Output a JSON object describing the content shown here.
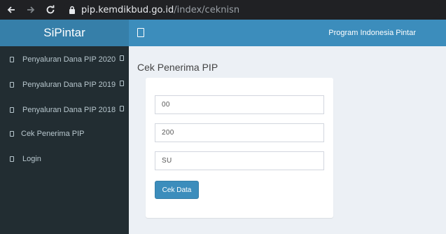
{
  "browser": {
    "url_host": "pip.kemdikbud.go.id",
    "url_path": "/index/ceknisn"
  },
  "app": {
    "brand": "SiPintar",
    "topbar_title": "Program Indonesia Pintar"
  },
  "sidebar": {
    "items": [
      {
        "label": "Penyaluran Dana PIP 2020",
        "has_caret": true
      },
      {
        "label": "Penyaluran Dana PIP 2019",
        "has_caret": true
      },
      {
        "label": "Penyaluran Dana PIP 2018",
        "has_caret": true
      },
      {
        "label": "Cek Penerima PIP",
        "has_caret": false
      },
      {
        "label": "Login",
        "has_caret": false
      }
    ]
  },
  "main": {
    "title": "Cek Penerima PIP",
    "fields": [
      {
        "value": "00"
      },
      {
        "value": "200"
      },
      {
        "value": "SU"
      }
    ],
    "submit_label": "Cek Data"
  },
  "colors": {
    "brand_bg": "#367fa9",
    "topbar_bg": "#3c8dbc",
    "sidebar_bg": "#222d32",
    "content_bg": "#ecf0f5"
  }
}
